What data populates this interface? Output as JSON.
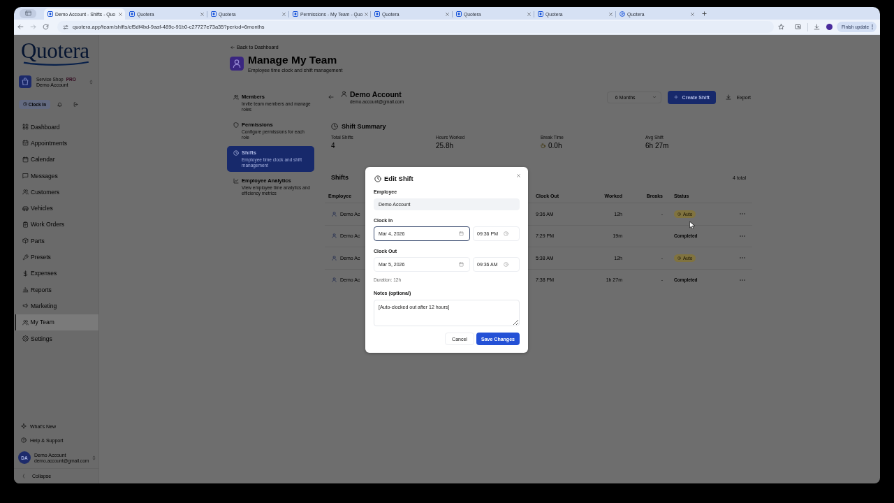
{
  "browser": {
    "tabs": [
      {
        "title": "Demo Account - Shifts - Quo",
        "kind": "page",
        "selected": true
      },
      {
        "title": "Quotera",
        "kind": "page",
        "selected": false
      },
      {
        "title": "Quotera",
        "kind": "page",
        "selected": false
      },
      {
        "title": "Permissions - My Team - Quo",
        "kind": "page",
        "selected": false
      },
      {
        "title": "Quotera",
        "kind": "page",
        "selected": false
      },
      {
        "title": "Quotera",
        "kind": "page",
        "selected": false
      },
      {
        "title": "Quotera",
        "kind": "page",
        "selected": false
      },
      {
        "title": "Quotera",
        "kind": "profile",
        "selected": false
      }
    ],
    "url": "quotera.app/team/shifts/cf5df4bd-9aaf-489c-91b0-c27727e73a35?period=6months",
    "update_button": "Finish update"
  },
  "sidebar": {
    "logo": "Quotera",
    "workspace": {
      "plan": "Service Shop",
      "badge": "PRO",
      "name": "Demo Account"
    },
    "clock_button": "Clock In",
    "items": [
      {
        "label": "Dashboard",
        "selected": false
      },
      {
        "label": "Appointments",
        "selected": false
      },
      {
        "label": "Calendar",
        "selected": false
      },
      {
        "label": "Messages",
        "selected": false
      },
      {
        "label": "Customers",
        "selected": false
      },
      {
        "label": "Vehicles",
        "selected": false
      },
      {
        "label": "Work Orders",
        "selected": false
      },
      {
        "label": "Parts",
        "selected": false
      },
      {
        "label": "Presets",
        "selected": false
      },
      {
        "label": "Expenses",
        "selected": false
      },
      {
        "label": "Reports",
        "selected": false
      },
      {
        "label": "Marketing",
        "selected": false
      },
      {
        "label": "My Team",
        "selected": true
      },
      {
        "label": "Settings",
        "selected": false
      }
    ],
    "footer_items": [
      "What's New",
      "Help & Support"
    ],
    "user": {
      "initials": "DA",
      "name": "Demo Account",
      "email": "demo.account@gmail.com"
    },
    "collapse": "Collapse"
  },
  "header": {
    "back_link": "Back to Dashboard",
    "title": "Manage My Team",
    "subtitle": "Employee time clock and shift management"
  },
  "subnav": [
    {
      "title": "Members",
      "description": "Invite team members and manage roles",
      "selected": false
    },
    {
      "title": "Permissions",
      "description": "Configure permissions for each role",
      "selected": false
    },
    {
      "title": "Shifts",
      "description": "Employee time clock and shift management",
      "selected": true
    },
    {
      "title": "Employee Analytics",
      "description": "View employee time analytics and efficiency metrics",
      "selected": false
    }
  ],
  "panel": {
    "name": "Demo Account",
    "email": "demo.account@gmail.com",
    "period": "6 Months",
    "create_button": "Create Shift",
    "export_button": "Export",
    "summary": {
      "title": "Shift Summary",
      "stats": [
        {
          "label": "Total Shifts",
          "value": "4",
          "kind": "plain"
        },
        {
          "label": "Hours Worked",
          "value": "25.8h",
          "kind": "plain"
        },
        {
          "label": "Break Time",
          "value": "0.0h",
          "kind": "break"
        },
        {
          "label": "Avg Shift",
          "value": "6h 27m",
          "kind": "plain"
        }
      ]
    },
    "shifts": {
      "title": "Shifts",
      "count": "4 total",
      "columns": [
        "Employee",
        "Clock Out",
        "Worked",
        "Breaks",
        "Status"
      ],
      "rows": [
        {
          "employee": "Demo Ac",
          "clock_out": "9:36 AM",
          "worked": "12h",
          "breaks": "-",
          "status": {
            "label": "Auto",
            "kind": "auto"
          }
        },
        {
          "employee": "Demo Ac",
          "clock_out": "7:29 PM",
          "worked": "19m",
          "status": {
            "label": "Completed",
            "kind": "completed"
          }
        },
        {
          "employee": "Demo Ac",
          "clock_out": "5:38 AM",
          "worked": "12h",
          "breaks": "-",
          "status": {
            "label": "Auto",
            "kind": "auto"
          }
        },
        {
          "employee": "Demo Ac",
          "clock_out": "7:38 PM",
          "worked": "1h 27m",
          "breaks": "-",
          "status": {
            "label": "Completed",
            "kind": "completed"
          }
        }
      ]
    }
  },
  "modal": {
    "title": "Edit Shift",
    "employee": {
      "label": "Employee",
      "value": "Demo Account",
      "disabled": true
    },
    "clock_in": {
      "label": "Clock In",
      "date": {
        "value": "Mar 4, 2026",
        "focused": true
      },
      "time": {
        "value": "09:36 PM",
        "focused": false
      }
    },
    "clock_out": {
      "label": "Clock Out",
      "date": {
        "value": "Mar 5, 2026",
        "focused": false
      },
      "time": {
        "value": "09:36 AM",
        "focused": false
      }
    },
    "duration": "Duration: 12h",
    "notes": {
      "label": "Notes (optional)",
      "value": "[Auto-clocked out after 12 hours]"
    },
    "cancel_button": "Cancel",
    "save_button": "Save Changes"
  }
}
